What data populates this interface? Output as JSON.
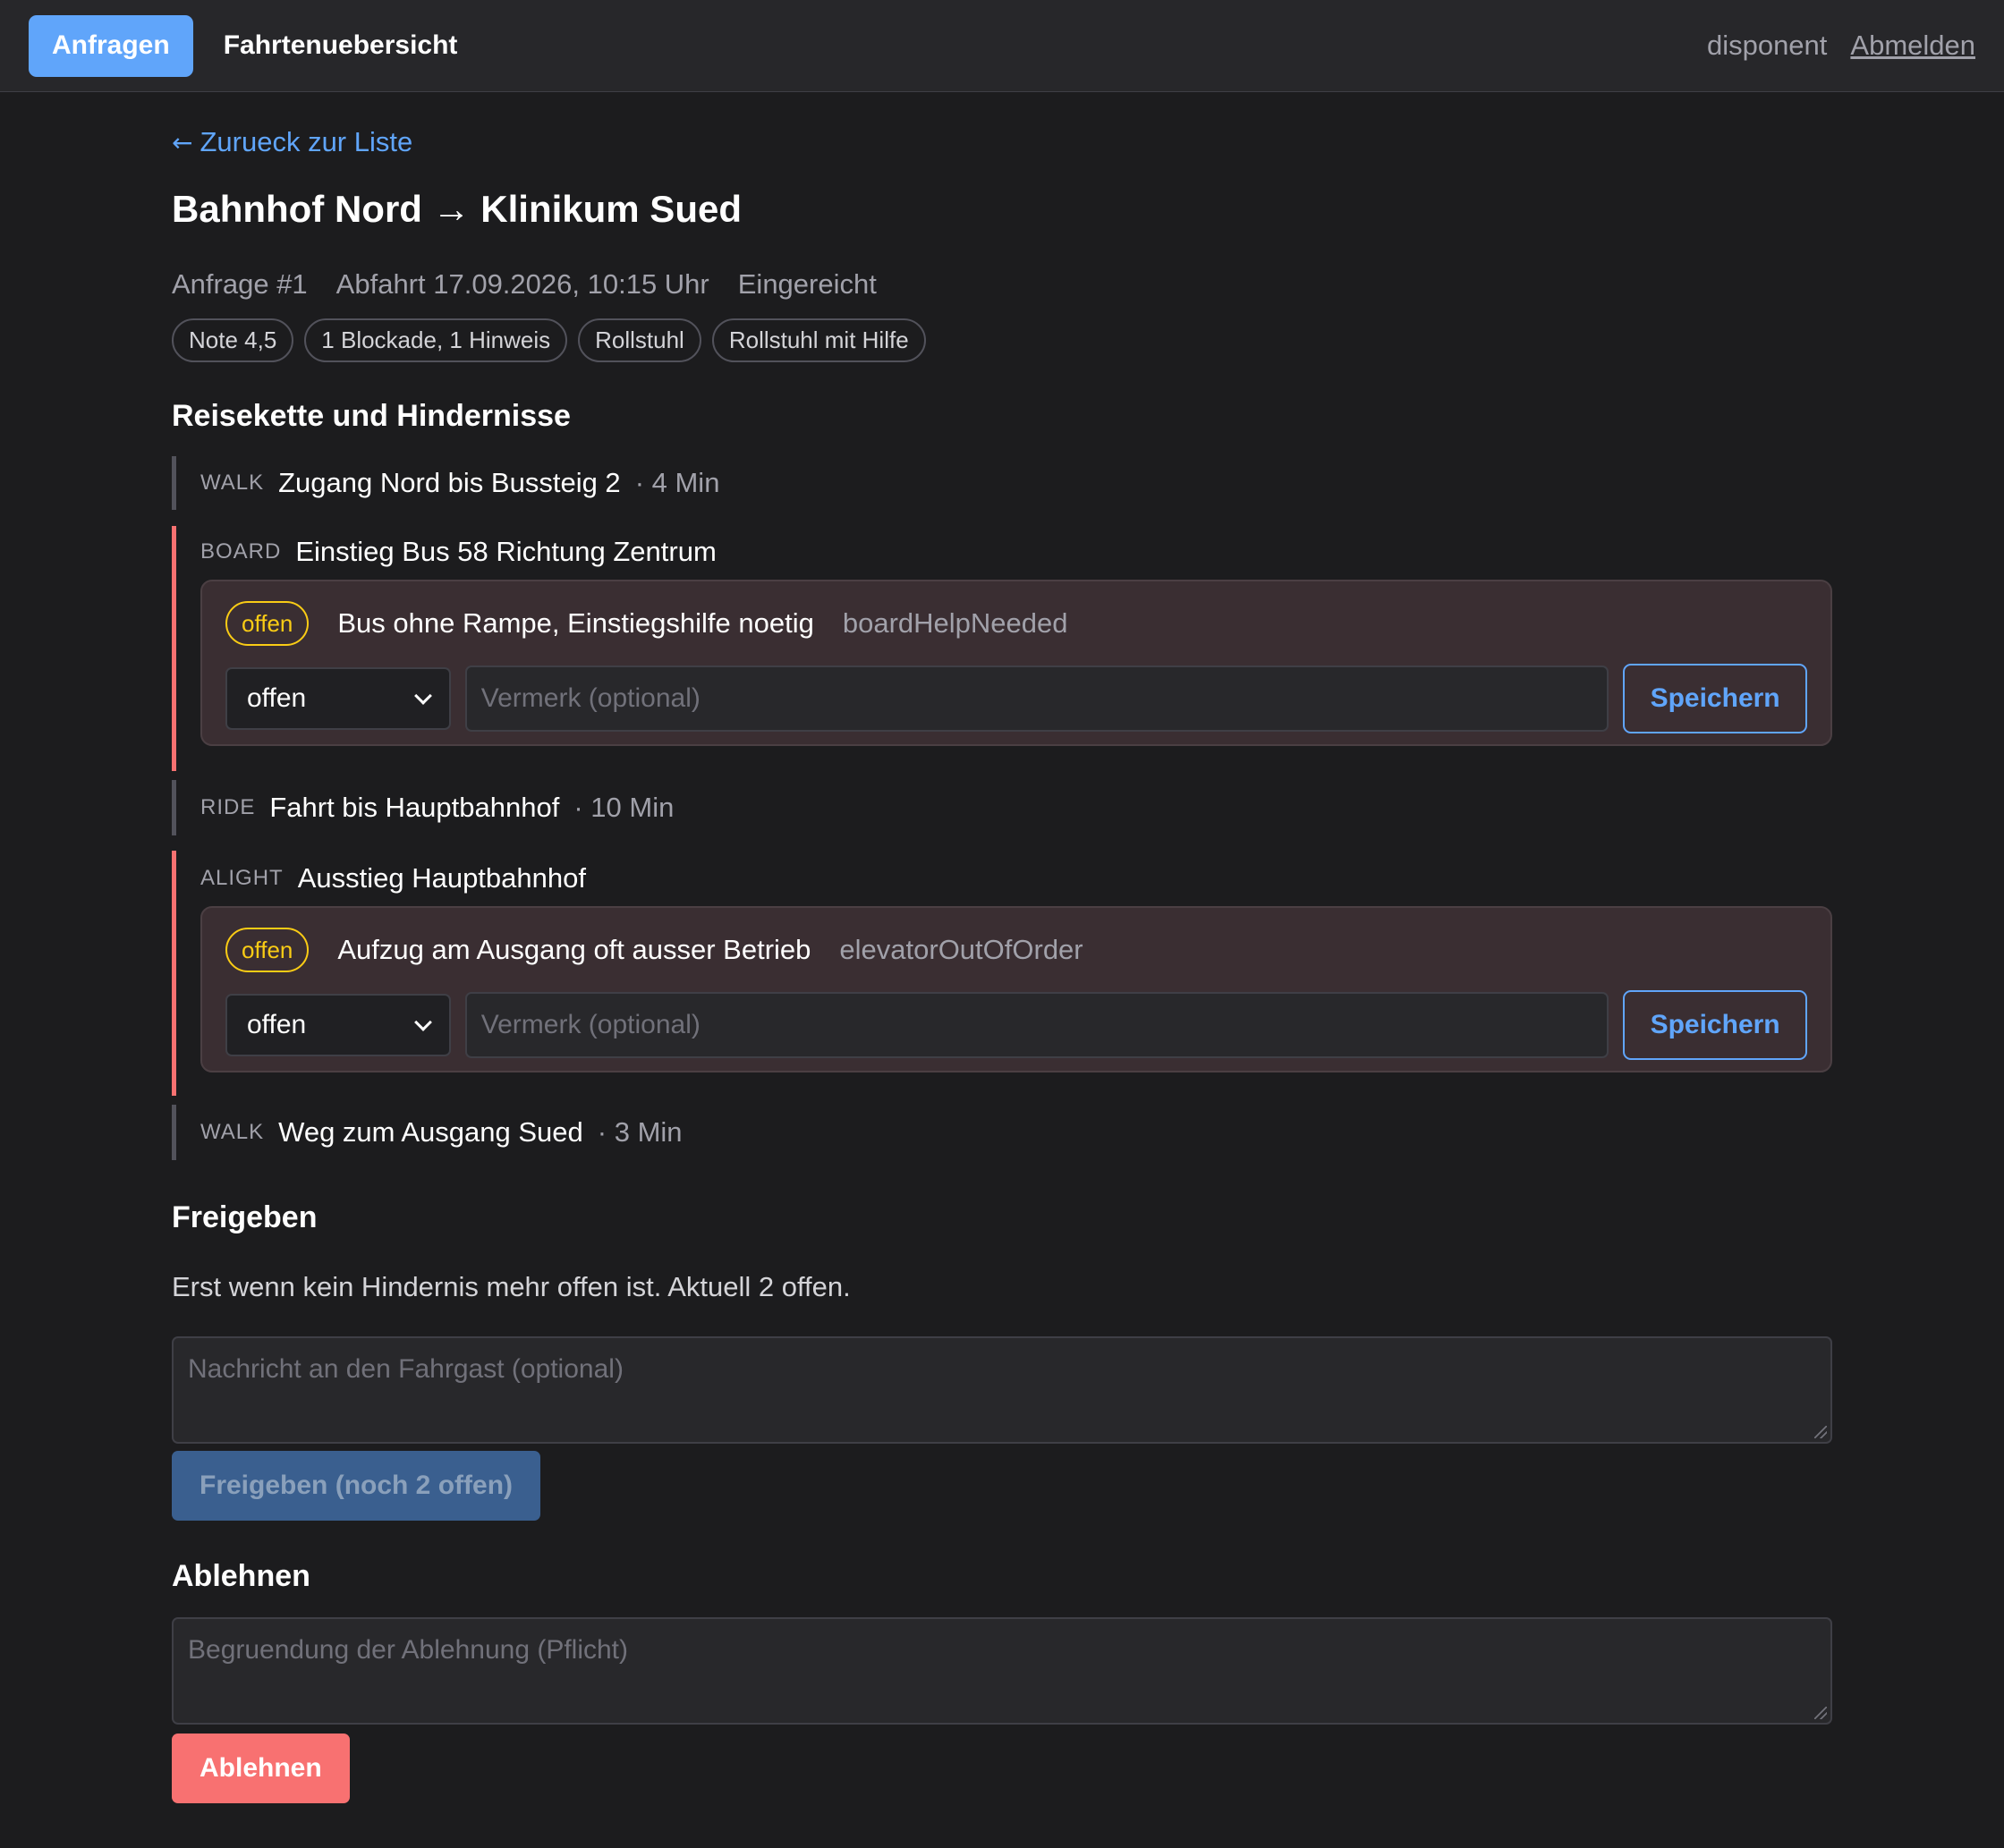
{
  "nav": {
    "tabs": [
      {
        "label": "Anfragen",
        "active": true
      },
      {
        "label": "Fahrtenuebersicht",
        "active": false
      }
    ],
    "user": "disponent",
    "logout": "Abmelden"
  },
  "back_link": "Zurueck zur Liste",
  "title": "Bahnhof Nord → Klinikum Sued",
  "meta": {
    "request": "Anfrage #1",
    "departure": "Abfahrt 17.09.2026, 10:15 Uhr",
    "status": "Eingereicht"
  },
  "chips": [
    "Note 4,5",
    "1 Blockade, 1 Hinweis",
    "Rollstuhl",
    "Rollstuhl mit Hilfe"
  ],
  "sections": {
    "chain_title": "Reisekette und Hindernisse",
    "release_title": "Freigeben",
    "reject_title": "Ablehnen"
  },
  "steps": [
    {
      "kind": "WALK",
      "description": "Zugang Nord bis Bussteig 2",
      "duration": "· 4 Min"
    },
    {
      "kind": "BOARD",
      "description": "Einstieg Bus 58 Richtung Zentrum",
      "issue": {
        "badge": "offen",
        "text": "Bus ohne Rampe, Einstiegshilfe noetig",
        "code": "boardHelpNeeded",
        "select": "offen",
        "note_placeholder": "Vermerk (optional)",
        "save": "Speichern"
      }
    },
    {
      "kind": "RIDE",
      "description": "Fahrt bis Hauptbahnhof",
      "duration": "· 10 Min"
    },
    {
      "kind": "ALIGHT",
      "description": "Ausstieg Hauptbahnhof",
      "issue": {
        "badge": "offen",
        "text": "Aufzug am Ausgang oft ausser Betrieb",
        "code": "elevatorOutOfOrder",
        "select": "offen",
        "note_placeholder": "Vermerk (optional)",
        "save": "Speichern"
      }
    },
    {
      "kind": "WALK",
      "description": "Weg zum Ausgang Sued",
      "duration": "· 3 Min"
    }
  ],
  "release": {
    "info": "Erst wenn kein Hindernis mehr offen ist. Aktuell 2 offen.",
    "message_placeholder": "Nachricht an den Fahrgast (optional)",
    "button": "Freigeben (noch 2 offen)"
  },
  "reject": {
    "reason_placeholder": "Begruendung der Ablehnung (Pflicht)",
    "button": "Ablehnen"
  },
  "colors": {
    "accent": "#60a5fa",
    "danger": "#f87171",
    "warning": "#facc15",
    "background": "#1c1c1e"
  }
}
